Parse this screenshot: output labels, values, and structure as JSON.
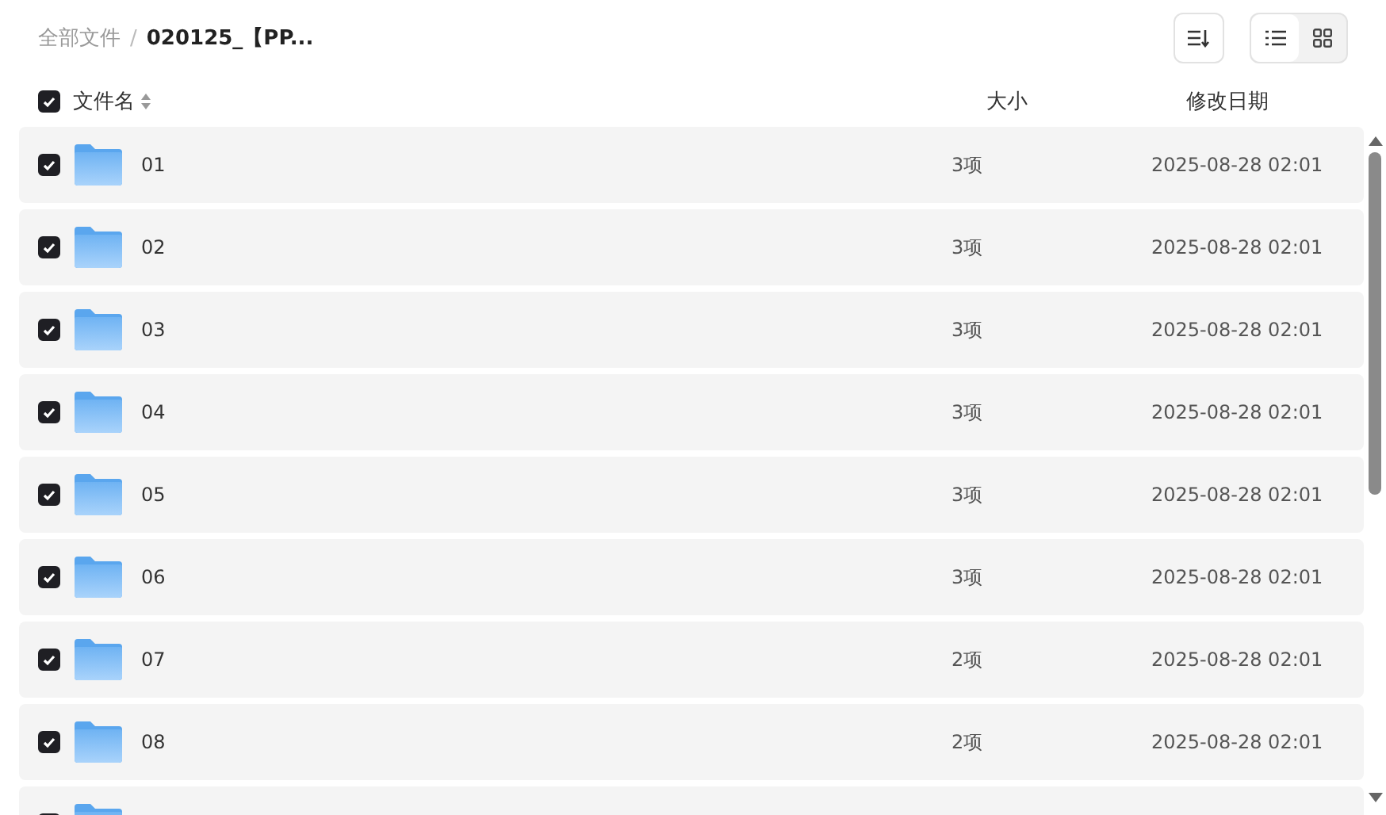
{
  "breadcrumb": [
    {
      "label": "全部文件",
      "current": false
    },
    {
      "label": "020125_【PP...",
      "current": true
    }
  ],
  "breadcrumb_separator": "/",
  "view_toggle": [
    {
      "kind": "list",
      "selected": true
    },
    {
      "kind": "grid",
      "selected": false
    }
  ],
  "header": {
    "checked": true,
    "columns": [
      "文件名",
      "大小",
      "修改日期"
    ]
  },
  "rows": [
    {
      "checked": true,
      "name": "01",
      "size": "3项",
      "modified": "2025-08-28 02:01"
    },
    {
      "checked": true,
      "name": "02",
      "size": "3项",
      "modified": "2025-08-28 02:01"
    },
    {
      "checked": true,
      "name": "03",
      "size": "3项",
      "modified": "2025-08-28 02:01"
    },
    {
      "checked": true,
      "name": "04",
      "size": "3项",
      "modified": "2025-08-28 02:01"
    },
    {
      "checked": true,
      "name": "05",
      "size": "3项",
      "modified": "2025-08-28 02:01"
    },
    {
      "checked": true,
      "name": "06",
      "size": "3项",
      "modified": "2025-08-28 02:01"
    },
    {
      "checked": true,
      "name": "07",
      "size": "2项",
      "modified": "2025-08-28 02:01"
    },
    {
      "checked": true,
      "name": "08",
      "size": "2项",
      "modified": "2025-08-28 02:01"
    },
    {
      "checked": true
    }
  ]
}
